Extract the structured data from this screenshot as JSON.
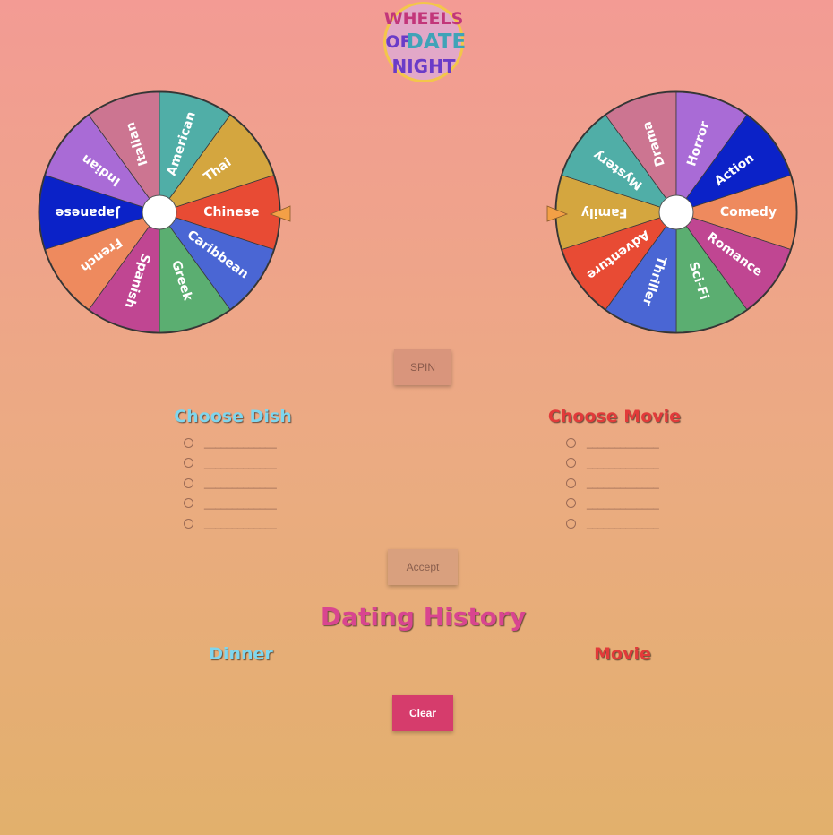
{
  "logo": {
    "line1": "WHEELS",
    "line2": "OF",
    "line3": "DATE",
    "line4": "NIGHT"
  },
  "dish_wheel": {
    "segments": [
      {
        "label": "Chinese",
        "color": "#e84b34"
      },
      {
        "label": "Caribbean",
        "color": "#4a66d4"
      },
      {
        "label": "Greek",
        "color": "#5bae71"
      },
      {
        "label": "Spanish",
        "color": "#c04692"
      },
      {
        "label": "French",
        "color": "#ee8a5e"
      },
      {
        "label": "Japanese",
        "color": "#0b22c8"
      },
      {
        "label": "Indian",
        "color": "#a96bd6"
      },
      {
        "label": "Italian",
        "color": "#cc7591"
      },
      {
        "label": "American",
        "color": "#50aea7"
      },
      {
        "label": "Thai",
        "color": "#d4a63f"
      }
    ],
    "pointer_color": "#f3a046"
  },
  "movie_wheel": {
    "segments": [
      {
        "label": "Comedy",
        "color": "#ee8a5e"
      },
      {
        "label": "Romance",
        "color": "#c04692"
      },
      {
        "label": "Sci-Fi",
        "color": "#5bae71"
      },
      {
        "label": "Thriller",
        "color": "#4a66d4"
      },
      {
        "label": "Adventure",
        "color": "#e84b34"
      },
      {
        "label": "Family",
        "color": "#d4a63f"
      },
      {
        "label": "Mystery",
        "color": "#50aea7"
      },
      {
        "label": "Drama",
        "color": "#cc7591"
      },
      {
        "label": "Horror",
        "color": "#a96bd6"
      },
      {
        "label": "Action",
        "color": "#0b22c8"
      }
    ],
    "pointer_color": "#f3a046"
  },
  "buttons": {
    "spin": "SPIN",
    "accept": "Accept",
    "clear": "Clear"
  },
  "choose_dish": {
    "title": "Choose Dish",
    "options": [
      "_____________",
      "_____________",
      "_____________",
      "_____________",
      "_____________"
    ]
  },
  "choose_movie": {
    "title": "Choose Movie",
    "options": [
      "_____________",
      "_____________",
      "_____________",
      "_____________",
      "_____________"
    ]
  },
  "history": {
    "title": "Dating History",
    "dinner": "Dinner",
    "movie": "Movie"
  }
}
